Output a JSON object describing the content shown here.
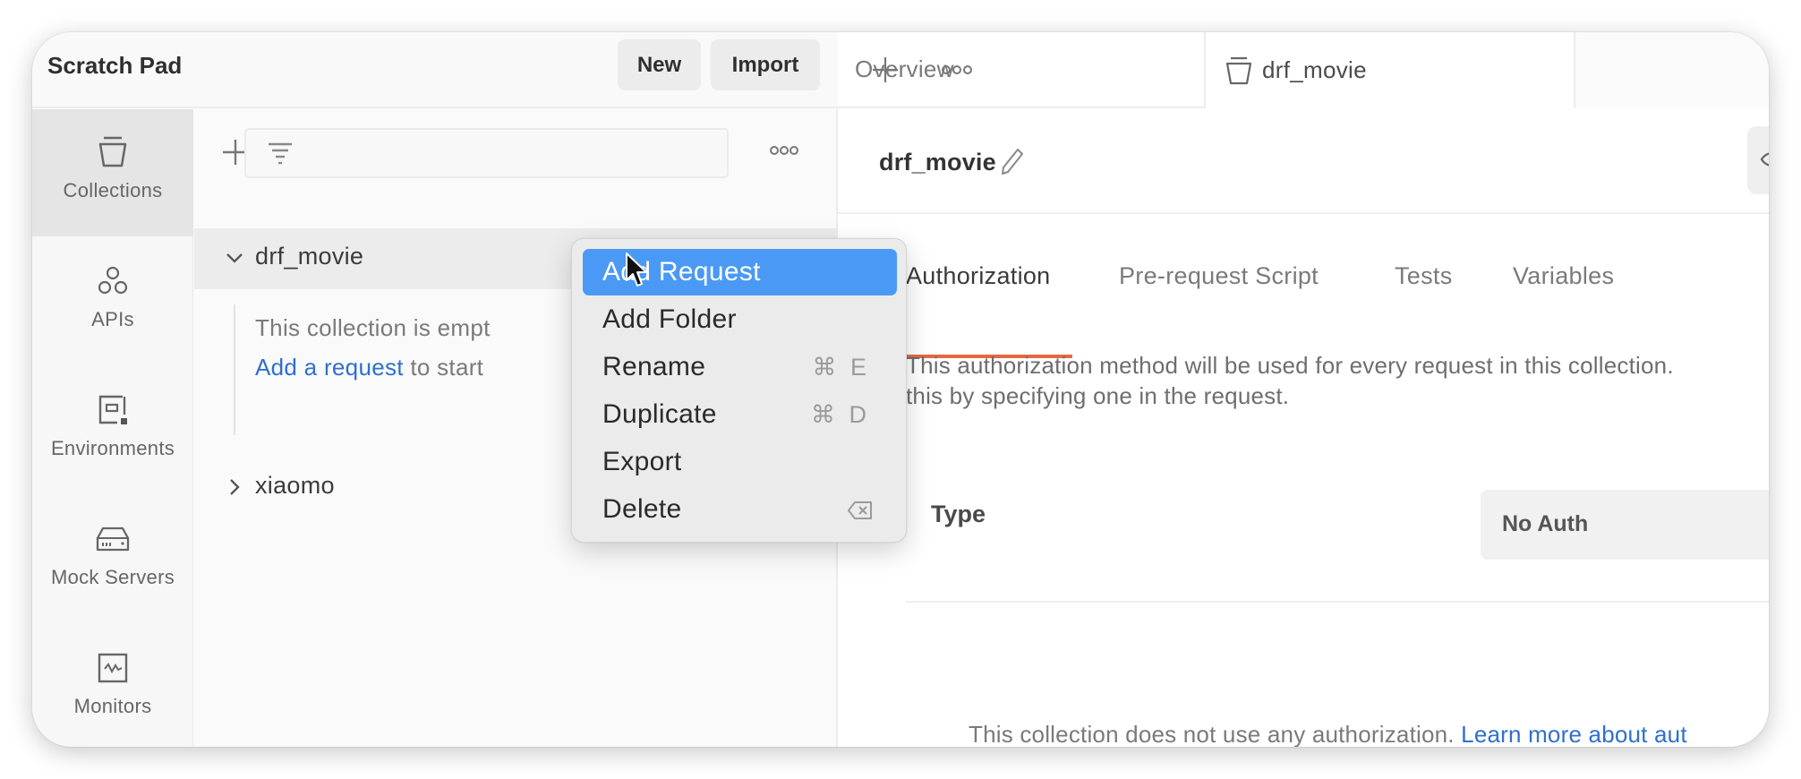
{
  "workspace": {
    "title": "Scratch Pad",
    "new_label": "New",
    "import_label": "Import"
  },
  "rail": {
    "items": [
      {
        "label": "Collections",
        "icon": "collection-icon",
        "active": true
      },
      {
        "label": "APIs",
        "icon": "apis-icon",
        "active": false
      },
      {
        "label": "Environments",
        "icon": "environments-icon",
        "active": false
      },
      {
        "label": "Mock Servers",
        "icon": "mock-server-icon",
        "active": false
      },
      {
        "label": "Monitors",
        "icon": "monitor-icon",
        "active": false
      }
    ]
  },
  "panel": {
    "search_placeholder": "",
    "collections": [
      {
        "name": "drf_movie",
        "expanded": true,
        "selected": true
      },
      {
        "name": "xiaomo",
        "expanded": false,
        "selected": false
      }
    ],
    "empty_line1": "This collection is empt",
    "empty_link": "Add a request",
    "empty_line2_rest": " to start"
  },
  "tabs": {
    "items": [
      {
        "label": "Overview",
        "active": false
      },
      {
        "label": "drf_movie",
        "active": true,
        "icon": "collection-icon"
      }
    ]
  },
  "content": {
    "title": "drf_movie",
    "subtabs": [
      "Authorization",
      "Pre-request Script",
      "Tests",
      "Variables"
    ],
    "active_subtab": "Authorization",
    "description_line1": "This authorization method will be used for every request in this collection.",
    "description_line2": "this by specifying one in the request.",
    "type_label": "Type",
    "type_value": "No Auth",
    "note_text": "This collection does not use any authorization. ",
    "note_link": "Learn more about aut"
  },
  "context_menu": {
    "items": [
      {
        "label": "Add Request",
        "shortcut": "",
        "highlighted": true
      },
      {
        "label": "Add Folder",
        "shortcut": "",
        "highlighted": false
      },
      {
        "label": "Rename",
        "shortcut": "⌘ E",
        "highlighted": false
      },
      {
        "label": "Duplicate",
        "shortcut": "⌘ D",
        "highlighted": false
      },
      {
        "label": "Export",
        "shortcut": "",
        "highlighted": false
      },
      {
        "label": "Delete",
        "shortcut": "",
        "icon": "delete-key-icon",
        "highlighted": false
      }
    ]
  },
  "colors": {
    "accent": "#e8683e",
    "menu_highlight": "#4a9af5",
    "link": "#2f6fcf"
  }
}
